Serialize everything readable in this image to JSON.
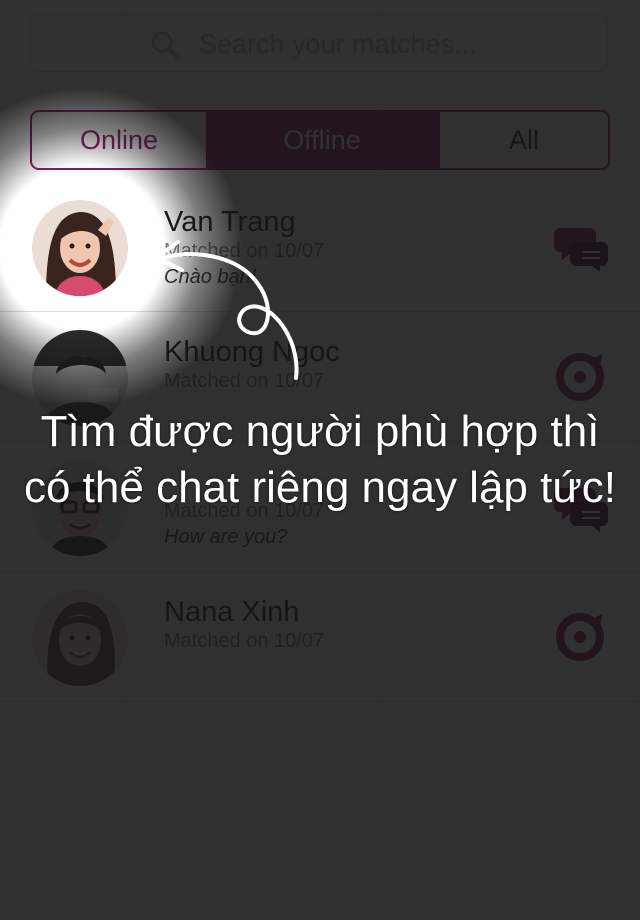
{
  "search": {
    "placeholder": "Search your matches..."
  },
  "tabs": [
    {
      "label": "Online",
      "selected": false
    },
    {
      "label": "Offline",
      "selected": true
    },
    {
      "label": "All",
      "selected": false
    }
  ],
  "colors": {
    "accent": "#8a1a67",
    "text": "#1a1a1a",
    "muted": "#7a7a7a"
  },
  "matches": [
    {
      "name": "Van Trang",
      "matched": "Matched on 10/07",
      "message": "Chào bạn!",
      "icon": "chat-icon"
    },
    {
      "name": "Khuong Ngoc",
      "matched": "Matched on 10/07",
      "message": "",
      "icon": "target-icon"
    },
    {
      "name": "",
      "matched": "Matched on 10/07",
      "message": "How are you?",
      "icon": "chat-icon"
    },
    {
      "name": "Nana Xinh",
      "matched": "Matched on 10/07",
      "message": "",
      "icon": "target-icon"
    }
  ],
  "coach": {
    "line1": "Tìm được người phù hợp thì",
    "line2": "có thể chat riêng ngay lập tức!"
  }
}
